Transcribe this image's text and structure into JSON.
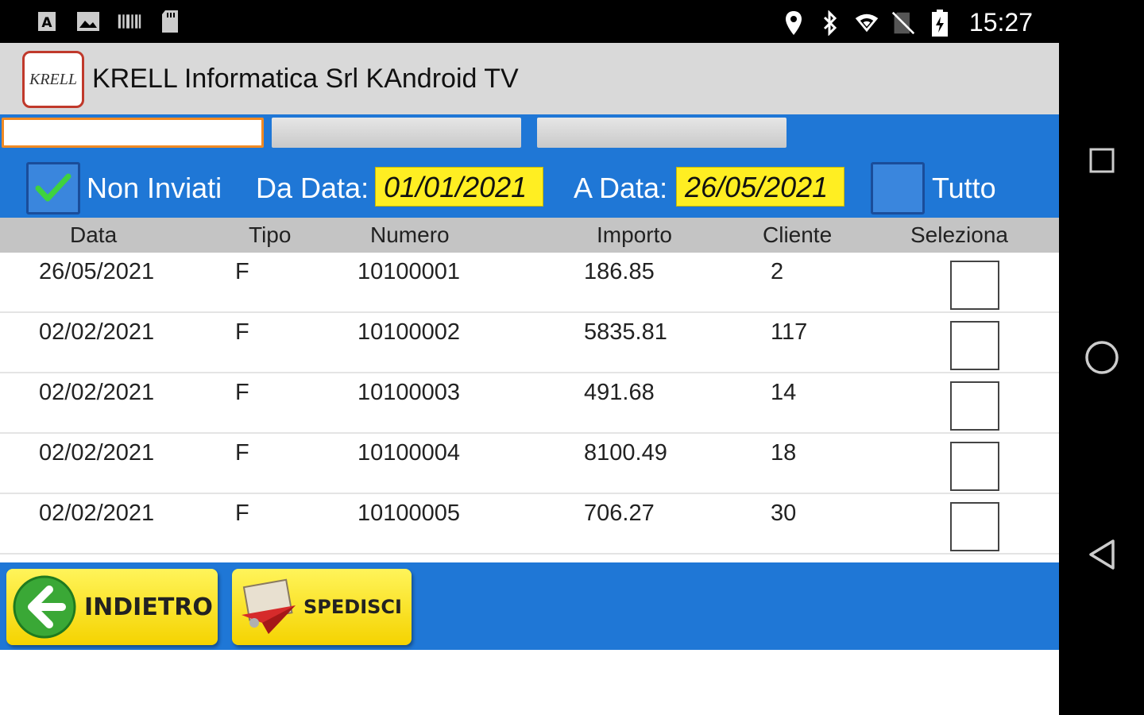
{
  "status_bar": {
    "time": "15:27",
    "left_icons": [
      "app-a-icon",
      "image-icon",
      "barcode-icon",
      "sd-card-icon"
    ],
    "right_icons": [
      "location-icon",
      "bluetooth-icon",
      "wifi-icon",
      "no-sim-icon",
      "battery-charging-icon"
    ]
  },
  "app": {
    "logo_text": "KRELL",
    "title": "KRELL Informatica Srl KAndroid TV"
  },
  "filters": {
    "non_inviati_label": "Non Inviati",
    "non_inviati_checked": true,
    "da_data_label": "Da Data:",
    "da_data_value": "01/01/2021",
    "a_data_label": "A Data:",
    "a_data_value": "26/05/2021",
    "tutto_label": "Tutto",
    "tutto_checked": false
  },
  "table": {
    "headers": [
      "Data",
      "Tipo",
      "Numero",
      "Importo",
      "Cliente",
      "Seleziona"
    ],
    "rows": [
      {
        "data": "26/05/2021",
        "tipo": "F",
        "numero": "10100001",
        "importo": "186.85",
        "cliente": "2"
      },
      {
        "data": "02/02/2021",
        "tipo": "F",
        "numero": "10100002",
        "importo": "5835.81",
        "cliente": "117"
      },
      {
        "data": "02/02/2021",
        "tipo": "F",
        "numero": "10100003",
        "importo": "491.68",
        "cliente": "14"
      },
      {
        "data": "02/02/2021",
        "tipo": "F",
        "numero": "10100004",
        "importo": "8100.49",
        "cliente": "18"
      },
      {
        "data": "02/02/2021",
        "tipo": "F",
        "numero": "10100005",
        "importo": "706.27",
        "cliente": "30"
      }
    ]
  },
  "actions": {
    "back_label": "INDIETRO",
    "send_label": "SPEDISCI"
  },
  "colors": {
    "accent_blue": "#1f77d6",
    "date_yellow": "#ffee22",
    "button_yellow": "#f5d300",
    "tab_active_border": "#f08a24"
  }
}
